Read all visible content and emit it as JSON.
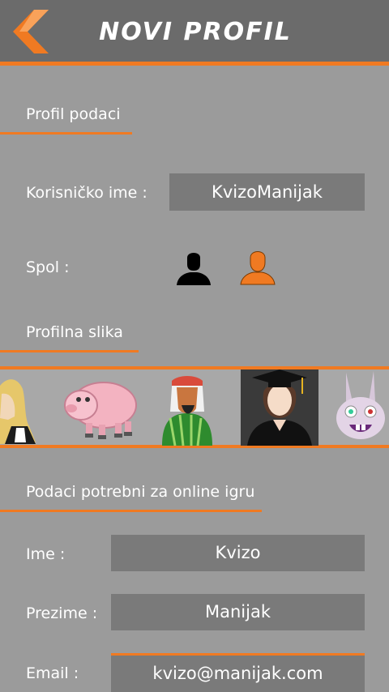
{
  "header": {
    "title": "NOVI PROFIL",
    "back_icon": "back-arrow-icon"
  },
  "profile_section": {
    "title": "Profil podaci",
    "username_label": "Korisničko ime :",
    "username_value": "KvizoManijak",
    "gender_label": "Spol :",
    "gender_options": [
      {
        "name": "female-user-icon",
        "color": "#000000",
        "selected": false
      },
      {
        "name": "male-user-icon",
        "color": "#f07a22",
        "selected": true
      }
    ]
  },
  "picture_section": {
    "title": "Profilna slika",
    "avatars": [
      {
        "name": "avatar-blonde-person",
        "selected": false
      },
      {
        "name": "avatar-pig",
        "selected": false
      },
      {
        "name": "avatar-arab-man",
        "selected": false
      },
      {
        "name": "avatar-graduate",
        "selected": true
      },
      {
        "name": "avatar-crazy-rabbit",
        "selected": false
      }
    ]
  },
  "online_section": {
    "title": "Podaci potrebni za online igru",
    "first_name_label": "Ime :",
    "first_name_value": "Kvizo",
    "last_name_label": "Prezime :",
    "last_name_value": "Manijak",
    "email_label": "Email :",
    "email_value": "kvizo@manijak.com"
  },
  "colors": {
    "accent": "#f07a22",
    "header": "#6b6b6b",
    "background": "#9b9b9b",
    "field": "#7a7a7a"
  }
}
